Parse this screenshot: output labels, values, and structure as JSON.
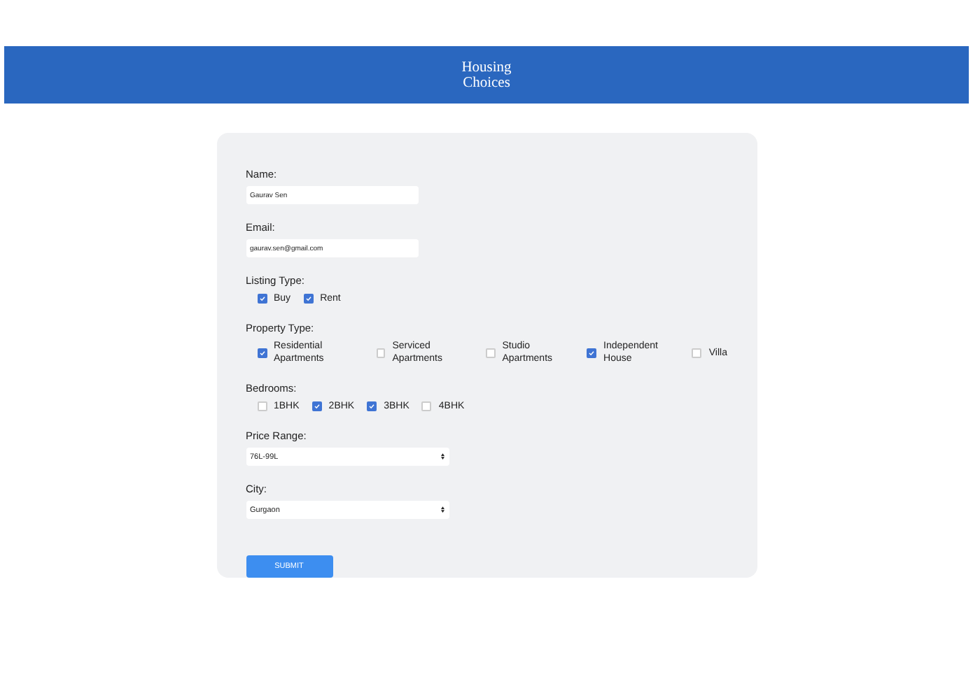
{
  "header": {
    "title": "Housing Choices"
  },
  "fields": [
    {
      "kind": "text",
      "label": "Name:",
      "value": "Gaurav Sen"
    },
    {
      "kind": "text",
      "label": "Email:",
      "value": "gaurav.sen@gmail.com"
    },
    {
      "kind": "checkboxes",
      "label": "Listing Type:",
      "options": [
        {
          "label": "Buy",
          "checked": true
        },
        {
          "label": "Rent",
          "checked": true
        }
      ]
    },
    {
      "kind": "checkboxes",
      "label": "Property Type:",
      "options": [
        {
          "label": "Residential Apartments",
          "checked": true
        },
        {
          "label": "Serviced Apartments",
          "checked": false
        },
        {
          "label": "Studio Apartments",
          "checked": false
        },
        {
          "label": "Independent House",
          "checked": true
        },
        {
          "label": "Villa",
          "checked": false
        }
      ]
    },
    {
      "kind": "checkboxes",
      "label": "Bedrooms:",
      "options": [
        {
          "label": "1BHK",
          "checked": false
        },
        {
          "label": "2BHK",
          "checked": true
        },
        {
          "label": "3BHK",
          "checked": true
        },
        {
          "label": "4BHK",
          "checked": false
        }
      ]
    },
    {
      "kind": "select",
      "label": "Price Range:",
      "value": "76L-99L"
    },
    {
      "kind": "select",
      "label": "City:",
      "value": "Gurgaon"
    }
  ],
  "submit": {
    "label": "SUBMIT"
  }
}
